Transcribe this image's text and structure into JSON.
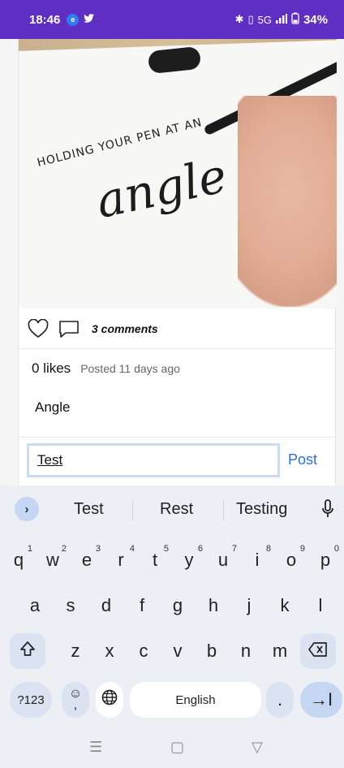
{
  "status_bar": {
    "time": "18:46",
    "left_icons": [
      "notification-icon",
      "twitter-icon"
    ],
    "right_icons": [
      "bluetooth-icon",
      "vibrate-icon",
      "signal-icon",
      "battery-icon"
    ],
    "battery": "34%",
    "signal_label": "5G"
  },
  "post": {
    "image_text_line1": "HOLDING YOUR PEN AT AN",
    "image_text_line2": "angle",
    "comments_label": "3 comments",
    "likes_label": "0 likes",
    "posted_label": "Posted 11 days ago",
    "caption": "Angle"
  },
  "comment": {
    "value": "Test",
    "post_label": "Post"
  },
  "keyboard": {
    "suggestions": [
      "Test",
      "Rest",
      "Testing"
    ],
    "row1": [
      {
        "k": "q",
        "n": "1"
      },
      {
        "k": "w",
        "n": "2"
      },
      {
        "k": "e",
        "n": "3"
      },
      {
        "k": "r",
        "n": "4"
      },
      {
        "k": "t",
        "n": "5"
      },
      {
        "k": "y",
        "n": "6"
      },
      {
        "k": "u",
        "n": "7"
      },
      {
        "k": "i",
        "n": "8"
      },
      {
        "k": "o",
        "n": "9"
      },
      {
        "k": "p",
        "n": "0"
      }
    ],
    "row2": [
      "a",
      "s",
      "d",
      "f",
      "g",
      "h",
      "j",
      "k",
      "l"
    ],
    "row3": [
      "z",
      "x",
      "c",
      "v",
      "b",
      "n",
      "m"
    ],
    "num_label": "?123",
    "emoji_comma": ",",
    "space_label": "English",
    "period": ".",
    "enter_label": "→I"
  },
  "colors": {
    "status_bar": "#5e2fc2",
    "link": "#2f6fd6",
    "keyboard_bg": "#eceff4"
  }
}
